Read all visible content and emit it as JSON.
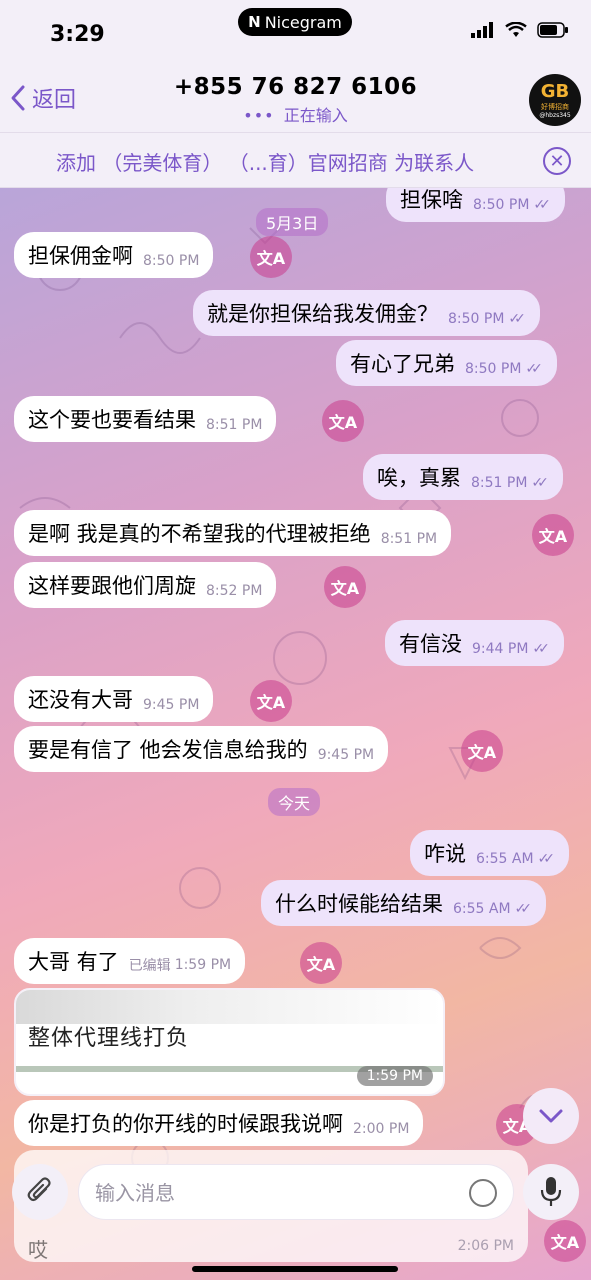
{
  "status_bar": {
    "time": "3:29",
    "app_name": "Nicegram"
  },
  "header": {
    "back_label": "返回",
    "title": "+855 76 827 6106",
    "subtitle": "正在输入",
    "avatar_logo": "GB",
    "avatar_text": "好博招商",
    "avatar_handle": "@hbzs345"
  },
  "add_bar": {
    "text": "添加 （完美体育） （...育）官网招商 为联系人"
  },
  "chat": {
    "date_may3": "5月3日",
    "date_today": "今天",
    "messages": [
      {
        "text": "担保啥",
        "time": "8:50 PM"
      },
      {
        "text": "担保佣金啊",
        "time": "8:50 PM"
      },
      {
        "text": "就是你担保给我发佣金？",
        "time": "8:50 PM"
      },
      {
        "text": "有心了兄弟",
        "time": "8:50 PM"
      },
      {
        "text": "这个要也要看结果",
        "time": "8:51 PM"
      },
      {
        "text": "唉，真累",
        "time": "8:51 PM"
      },
      {
        "text": "是啊  我是真的不希望我的代理被拒绝",
        "time": "8:51 PM"
      },
      {
        "text": "这样要跟他们周旋",
        "time": "8:52 PM"
      },
      {
        "text": "有信没",
        "time": "9:44 PM"
      },
      {
        "text": "还没有大哥",
        "time": "9:45 PM"
      },
      {
        "text": "要是有信了  他会发信息给我的",
        "time": "9:45 PM"
      },
      {
        "text": "咋说",
        "time": "6:55 AM"
      },
      {
        "text": "什么时候能给结果",
        "time": "6:55 AM"
      },
      {
        "text": "大哥    有了",
        "edited": "已编辑",
        "time": "1:59 PM"
      },
      {
        "text": "你是打负的你开线的时候跟我说啊",
        "time": "2:00 PM"
      },
      {
        "text": "哎",
        "time": "2:06 PM"
      }
    ],
    "media": {
      "caption": "整体代理线打负",
      "time": "1:59 PM"
    },
    "translate_label": "文A"
  },
  "input": {
    "placeholder": "输入消息"
  },
  "colors": {
    "accent": "#7b57c9",
    "outgoing_bubble": "#eee3fb",
    "incoming_bubble": "#ffffff"
  }
}
